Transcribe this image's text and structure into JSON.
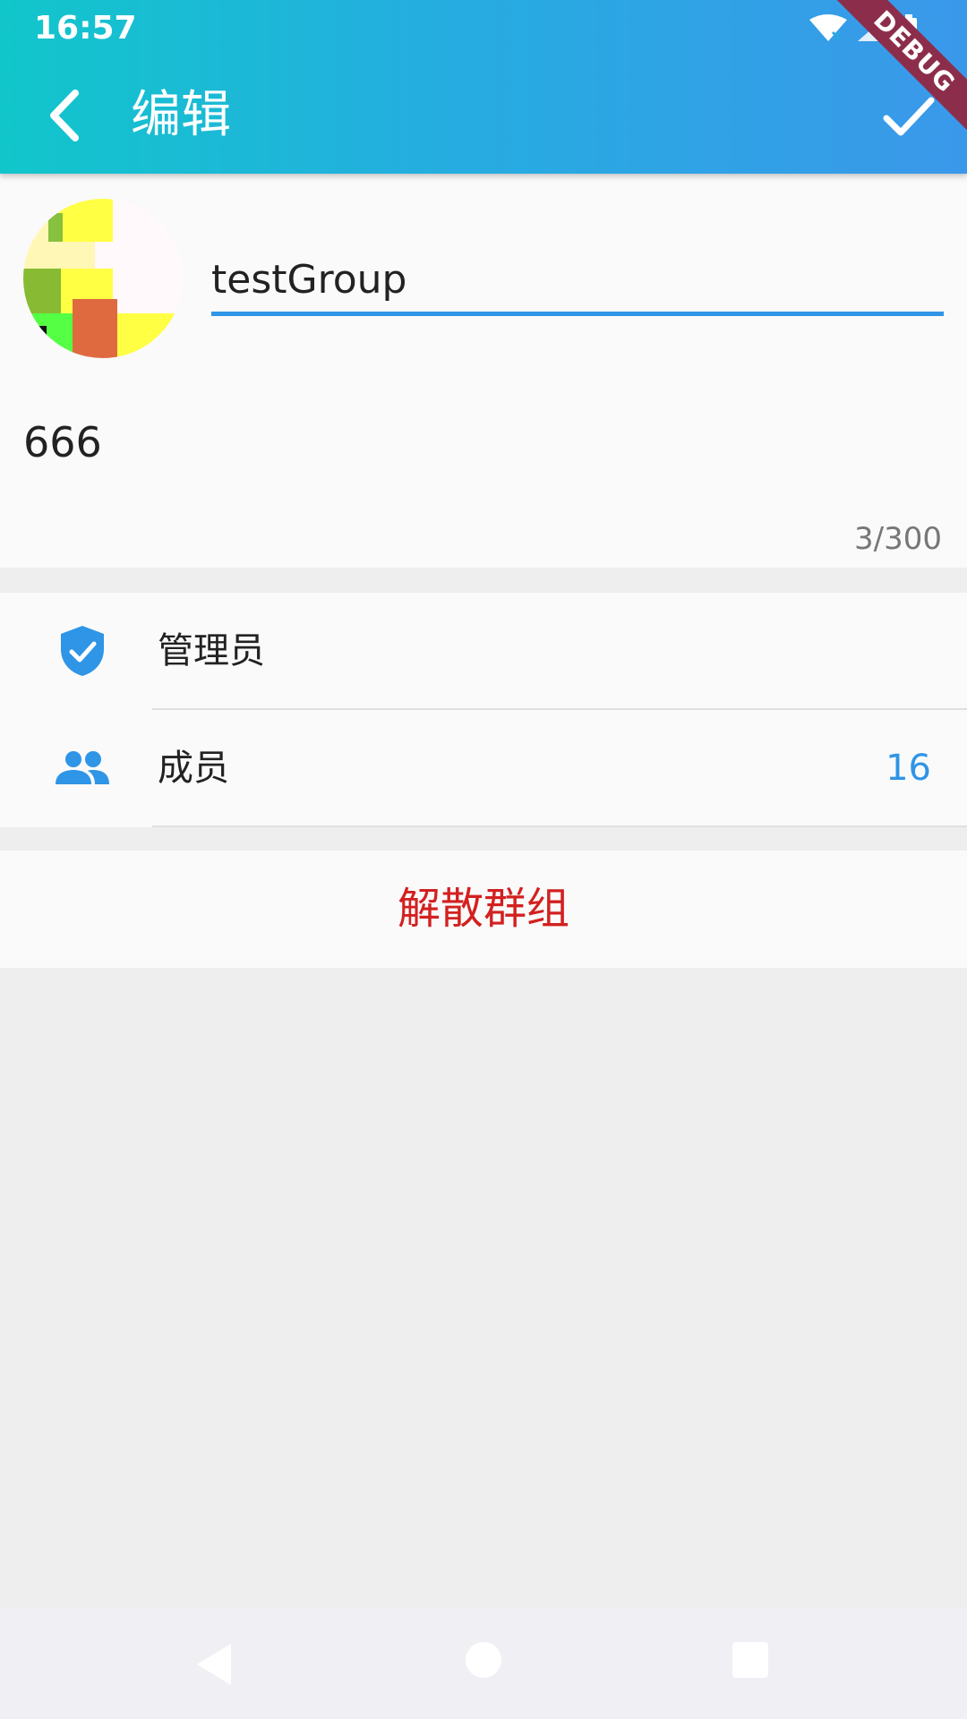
{
  "status_bar": {
    "time": "16:57",
    "debug_label": "DEBUG"
  },
  "app_bar": {
    "title": "编辑",
    "back_icon": "chevron-left-icon",
    "confirm_icon": "check-icon"
  },
  "group": {
    "name_value": "testGroup",
    "description_value": "666",
    "description_counter": "3/300"
  },
  "list": {
    "admins": {
      "label": "管理员",
      "icon": "shield-check-icon"
    },
    "members": {
      "label": "成员",
      "count": "16",
      "icon": "people-icon"
    }
  },
  "dissolve_button": {
    "label": "解散群组"
  },
  "colors": {
    "accent": "#2f95e6",
    "danger": "#d32020",
    "header_gradient_start": "#11c6cb",
    "header_gradient_end": "#3a98ea"
  }
}
